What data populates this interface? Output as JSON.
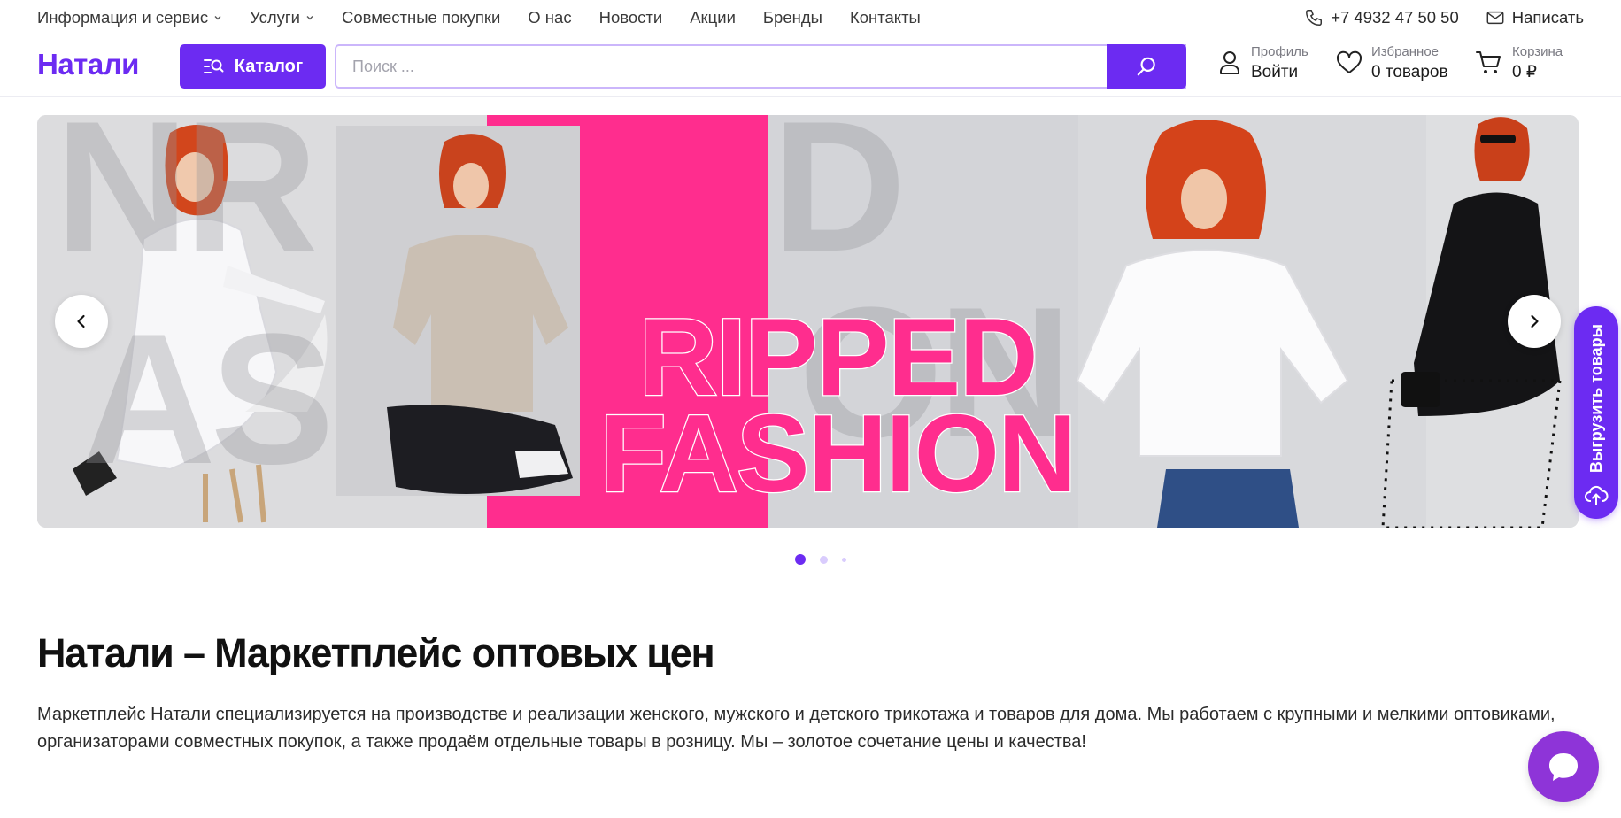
{
  "topnav": {
    "items": [
      {
        "label": "Информация и сервис",
        "has_dropdown": true
      },
      {
        "label": "Услуги",
        "has_dropdown": true
      },
      {
        "label": "Совместные покупки",
        "has_dropdown": false
      },
      {
        "label": "О нас",
        "has_dropdown": false
      },
      {
        "label": "Новости",
        "has_dropdown": false
      },
      {
        "label": "Акции",
        "has_dropdown": false
      },
      {
        "label": "Бренды",
        "has_dropdown": false
      },
      {
        "label": "Контакты",
        "has_dropdown": false
      }
    ],
    "phone": "+7 4932 47 50 50",
    "write_label": "Написать"
  },
  "header": {
    "logo": "Натали",
    "catalog_label": "Каталог",
    "search_placeholder": "Поиск ...",
    "profile": {
      "small": "Профиль",
      "big": "Войти"
    },
    "favorites": {
      "small": "Избранное",
      "big": "0 товаров"
    },
    "cart": {
      "small": "Корзина",
      "big": "0 ₽"
    }
  },
  "banner": {
    "headline_line1": "RIPPED",
    "headline_line2": "FASHION",
    "active_slide": 1,
    "slide_count": 3
  },
  "export_tab": {
    "label": "Выгрузить товары"
  },
  "content": {
    "title": "Натали – Маркетплейс оптовых цен",
    "text": "Маркетплейс Натали специализируется на производстве и реализации женского, мужского и детского трикотажа и товаров для дома. Мы работаем с крупными и мелкими оптовиками, организаторами совместных покупок, а также продаём отдельные товары в розницу. Мы – золотое сочетание цены и качества!"
  },
  "colors": {
    "accent": "#6c2bf2",
    "banner_pink": "#ff2d8e",
    "chat": "#8e34d8"
  },
  "icons": [
    "chevron-down-icon",
    "phone-icon",
    "mail-icon",
    "catalog-search-icon",
    "search-icon",
    "user-icon",
    "heart-icon",
    "cart-icon",
    "arrow-left-icon",
    "arrow-right-icon",
    "cloud-upload-icon",
    "chat-icon"
  ]
}
